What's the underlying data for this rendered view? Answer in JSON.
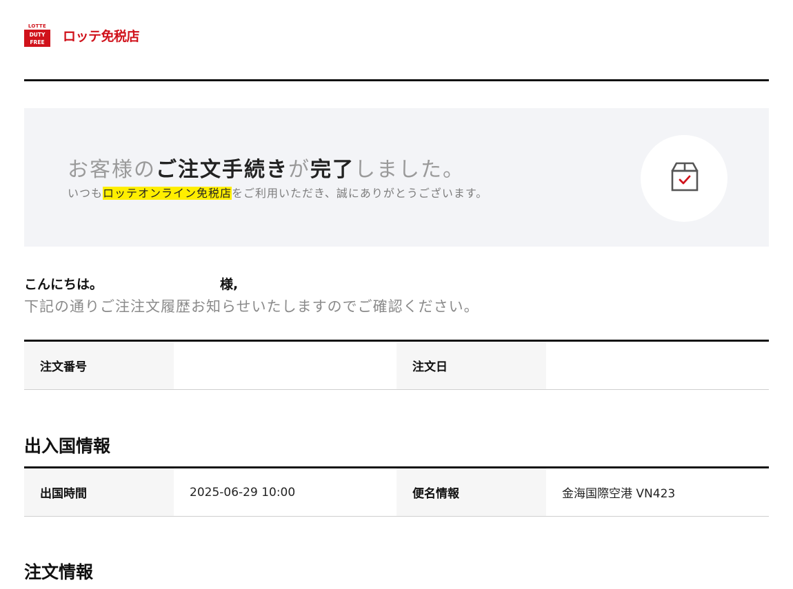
{
  "logo": {
    "mark_top": "LOTTE",
    "mark_line1": "DUTY",
    "mark_line2": "FREE",
    "brand_text": "ロッテ免税店"
  },
  "banner": {
    "title_part1": "お客様の",
    "title_bold1": "ご注文手続き",
    "title_part2": "が",
    "title_bold2": "完了",
    "title_part3": "しました。",
    "subtitle_before": "いつも",
    "subtitle_highlight": "ロッテオンライン免税店",
    "subtitle_after": "をご利用いただき、誠にありがとうございます。",
    "icon": "box-check-icon"
  },
  "greeting": {
    "hello": "こんにちは。",
    "honorific": "様,",
    "intro": "下記の通りご注注文履歴お知らせいたしますのでご確認ください。"
  },
  "order_table": {
    "order_number_label": "注文番号",
    "order_number_value": "",
    "order_date_label": "注文日",
    "order_date_value": ""
  },
  "departure_section": {
    "title": "出入国情報",
    "departure_time_label": "出国時間",
    "departure_time_value": "2025-06-29 10:00",
    "flight_label": "便名情報",
    "flight_value": "金海国際空港 VN423"
  },
  "order_info_section": {
    "title": "注文情報"
  },
  "colors": {
    "brand_red": "#d0121b",
    "highlight_yellow": "#ffee00",
    "banner_bg": "#f3f4f7"
  }
}
